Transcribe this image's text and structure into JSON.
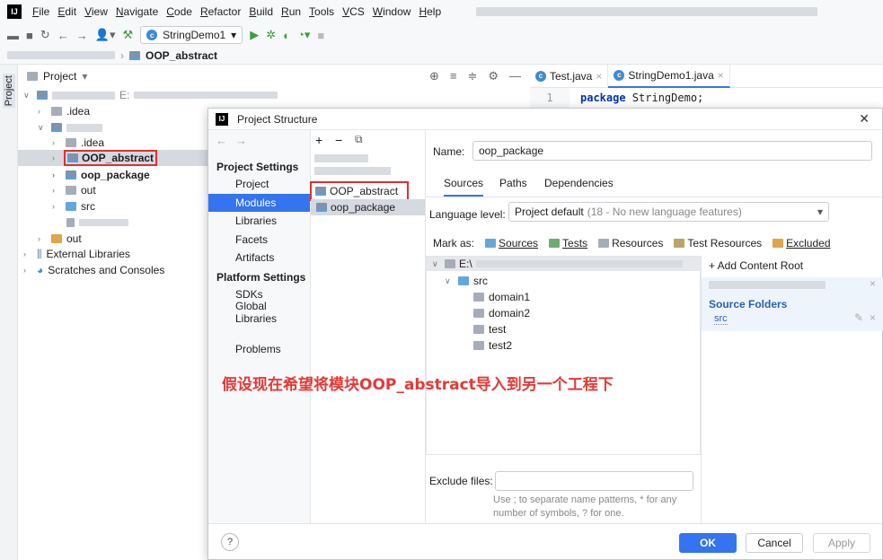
{
  "menubar": {
    "items": [
      "File",
      "Edit",
      "View",
      "Navigate",
      "Code",
      "Refactor",
      "Build",
      "Run",
      "Tools",
      "VCS",
      "Window",
      "Help"
    ]
  },
  "toolbar": {
    "run_config": "StringDemo1"
  },
  "breadcrumb": {
    "current": "OOP_abstract"
  },
  "side_stripe": {
    "label": "Project"
  },
  "project_panel": {
    "header": "Project",
    "tree": {
      "root_path_prefix": "E:",
      "idea": ".idea",
      "inner_idea": ".idea",
      "oop_abstract": "OOP_abstract",
      "oop_package": "oop_package",
      "out_inner": "out",
      "src": "src",
      "out": "out",
      "external_libraries": "External Libraries",
      "scratches": "Scratches and Consoles"
    }
  },
  "editor": {
    "tabs": [
      "Test.java",
      "StringDemo1.java"
    ],
    "line_number": "1",
    "line_keyword": "package",
    "line_rest": " StringDemo;"
  },
  "dialog": {
    "title": "Project Structure",
    "nav": {
      "project_settings": "Project Settings",
      "project": "Project",
      "modules": "Modules",
      "libraries": "Libraries",
      "facets": "Facets",
      "artifacts": "Artifacts",
      "platform_settings": "Platform Settings",
      "sdks": "SDKs",
      "global_libraries": "Global Libraries",
      "problems": "Problems"
    },
    "modules": [
      "OOP_abstract",
      "oop_package"
    ],
    "name_label": "Name:",
    "name_value": "oop_package",
    "tabs": [
      "Sources",
      "Paths",
      "Dependencies"
    ],
    "language_level_label": "Language level:",
    "language_level_value": "Project default",
    "language_level_hint": "(18 - No new language features)",
    "mark_as_label": "Mark as:",
    "mark_as": [
      "Sources",
      "Tests",
      "Resources",
      "Test Resources",
      "Excluded"
    ],
    "content_root_prefix": "E:\\",
    "tree": [
      "src",
      "domain1",
      "domain2",
      "test",
      "test2"
    ],
    "add_content_root": "+ Add Content Root",
    "source_folders_title": "Source Folders",
    "source_folder": "src",
    "exclude_files_label": "Exclude files:",
    "exclude_hint_1": "Use ; to separate name patterns, * for any",
    "exclude_hint_2": "number of symbols, ? for one.",
    "buttons": {
      "ok": "OK",
      "cancel": "Cancel",
      "apply": "Apply",
      "help": "?"
    }
  },
  "annotation": "假设现在希望将模块OOP_abstract导入到另一个工程下"
}
